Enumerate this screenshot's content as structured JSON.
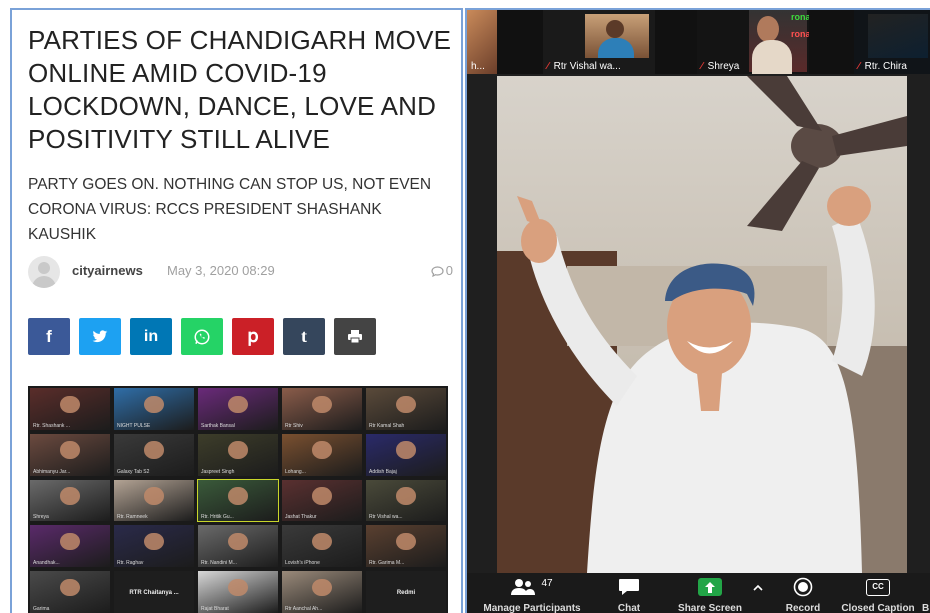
{
  "article": {
    "headline": "PARTIES OF CHANDIGARH MOVE ONLINE AMID COVID-19 LOCKDOWN, DANCE, LOVE AND POSITIVITY STILL ALIVE",
    "subhead": "PARTY GOES ON. NOTHING CAN STOP US, NOT EVEN CORONA VIRUS: RCCS PRESIDENT SHASHANK KAUSHIK",
    "author": "cityairnews",
    "date": "May 3, 2020 08:29",
    "comment_count": "0",
    "share_buttons": [
      {
        "icon": "facebook-icon",
        "glyph": "f",
        "color": "#3b5998"
      },
      {
        "icon": "twitter-icon",
        "glyph": "t",
        "color": "#1da1f2"
      },
      {
        "icon": "linkedin-icon",
        "glyph": "in",
        "color": "#0077b5"
      },
      {
        "icon": "whatsapp-icon",
        "glyph": "w",
        "color": "#25d366"
      },
      {
        "icon": "pinterest-icon",
        "glyph": "P",
        "color": "#cb2027"
      },
      {
        "icon": "tumblr-icon",
        "glyph": "t",
        "color": "#35465c"
      },
      {
        "icon": "print-icon",
        "glyph": "print",
        "color": "#444444"
      }
    ],
    "grid_labels": [
      "Rtr. Shashank ...",
      "NIGHT PULSE",
      "Sarthak Bansal",
      "Rtr Shiv",
      "Rtr Kamal Shah",
      "Abhimanyu Jar...",
      "Galaxy Tab S2",
      "Jaspreet Singh",
      "Lohang...",
      "Addish Bajaj",
      "Shreya",
      "Rtr. Ramneek",
      "Rtr. Hritik Gu...",
      "Jashat Thakur",
      "Rtr Vishal wa...",
      "Anandhak...",
      "Rtr. Raghav",
      "Rtr. Nandini M...",
      "Lovish's iPhone",
      "Rtr. Garima M...",
      "Garima",
      "RTR Chaitanya ...",
      "Rajat Bharat",
      "Rtr Aanchal Ah...",
      "Redmi"
    ]
  },
  "zoom": {
    "participants": [
      {
        "name": "h..."
      },
      {
        "name": "Rtr Vishal wa..."
      },
      {
        "name": "Shreya"
      },
      {
        "name": "Rtr. Chira"
      }
    ],
    "banner_text": "rona",
    "participant_count": "47",
    "toolbar": {
      "manage_participants": "Manage Participants",
      "chat": "Chat",
      "share_screen": "Share Screen",
      "record": "Record",
      "closed_caption": "Closed Caption",
      "cc_badge": "CC",
      "truncated": "B"
    }
  },
  "colors": {
    "frame_border": "#7aa2d8",
    "zoom_bg": "#1f1f1f",
    "share_green": "#22a547",
    "mic_red": "#e53935"
  }
}
